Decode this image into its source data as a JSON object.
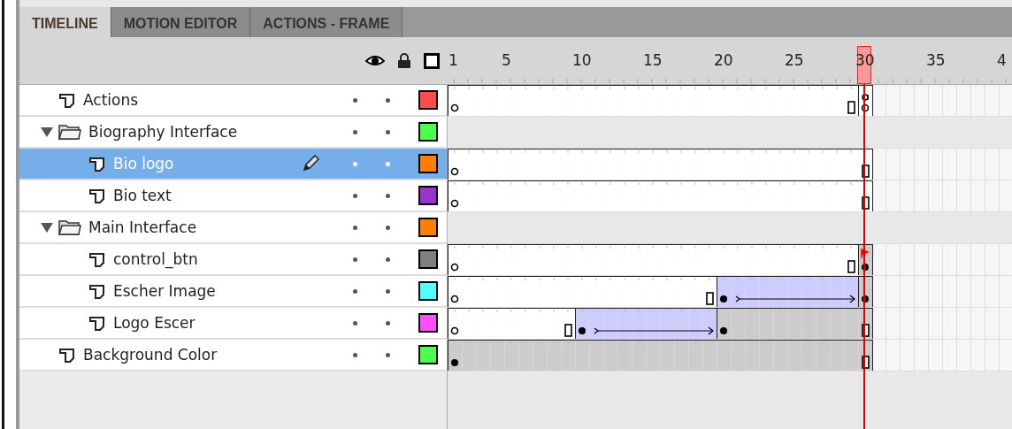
{
  "tabs": [
    {
      "label": "TIMELINE",
      "selected": true
    },
    {
      "label": "MOTION EDITOR",
      "selected": false
    },
    {
      "label": "ACTIONS - FRAME",
      "selected": false
    }
  ],
  "ruler": {
    "labels": [
      {
        "label": "1",
        "selected": false
      },
      {
        "label": "5",
        "selected": false
      },
      {
        "label": "10",
        "selected": false
      },
      {
        "label": "15",
        "selected": false
      },
      {
        "label": "20",
        "selected": false
      },
      {
        "label": "25",
        "selected": false
      },
      {
        "label": "30",
        "selected": true
      },
      {
        "label": "35",
        "selected": false
      },
      {
        "label": "4",
        "selected": false
      }
    ]
  },
  "layers": [
    {
      "name": "Actions",
      "kind": "layer",
      "selected": false,
      "color": "#ff4d4d",
      "frames": [
        {
          "kind": "blank",
          "keyframe": true
        },
        {
          "kind": "blank",
          "keyframe": false
        },
        {
          "kind": "blank",
          "keyframe": false
        },
        {
          "kind": "blank",
          "keyframe": false
        },
        {
          "kind": "blank",
          "keyframe": false
        },
        {
          "kind": "blank",
          "keyframe": false
        },
        {
          "kind": "blank",
          "keyframe": false
        },
        {
          "kind": "blank",
          "keyframe": false
        },
        {
          "kind": "blank",
          "keyframe": false
        },
        {
          "kind": "blank",
          "keyframe": false
        },
        {
          "kind": "blank",
          "keyframe": false
        },
        {
          "kind": "blank",
          "keyframe": false
        },
        {
          "kind": "blank",
          "keyframe": false
        },
        {
          "kind": "blank",
          "keyframe": false
        },
        {
          "kind": "blank",
          "keyframe": false
        },
        {
          "kind": "blank",
          "keyframe": false
        },
        {
          "kind": "blank",
          "keyframe": false
        },
        {
          "kind": "blank",
          "keyframe": false
        },
        {
          "kind": "blank",
          "keyframe": false
        },
        {
          "kind": "blank",
          "keyframe": false
        },
        {
          "kind": "blank",
          "keyframe": false
        },
        {
          "kind": "blank",
          "keyframe": false
        },
        {
          "kind": "blank",
          "keyframe": false
        },
        {
          "kind": "blank",
          "keyframe": false
        },
        {
          "kind": "blank",
          "keyframe": false
        },
        {
          "kind": "blank",
          "keyframe": false
        },
        {
          "kind": "blank",
          "keyframe": false
        },
        {
          "kind": "blank",
          "keyframe": false
        },
        {
          "kind": "blank",
          "keyframe": false
        },
        {
          "kind": "blank",
          "keyframe": true,
          "action": true
        }
      ]
    },
    {
      "name": "Biography Interface",
      "kind": "folder",
      "expanded": true,
      "selected": false,
      "color": "#4dff4d",
      "children": [
        {
          "name": "Bio logo",
          "kind": "layer",
          "selected": true,
          "color": "#ff8000",
          "frames": [
            {
              "kind": "blank",
              "keyframe": true
            },
            {
              "kind": "blank",
              "keyframe": false
            },
            {
              "kind": "blank",
              "keyframe": false
            },
            {
              "kind": "blank",
              "keyframe": false
            },
            {
              "kind": "blank",
              "keyframe": false
            },
            {
              "kind": "blank",
              "keyframe": false
            },
            {
              "kind": "blank",
              "keyframe": false
            },
            {
              "kind": "blank",
              "keyframe": false
            },
            {
              "kind": "blank",
              "keyframe": false
            },
            {
              "kind": "blank",
              "keyframe": false
            },
            {
              "kind": "blank",
              "keyframe": false
            },
            {
              "kind": "blank",
              "keyframe": false
            },
            {
              "kind": "blank",
              "keyframe": false
            },
            {
              "kind": "blank",
              "keyframe": false
            },
            {
              "kind": "blank",
              "keyframe": false
            },
            {
              "kind": "blank",
              "keyframe": false
            },
            {
              "kind": "blank",
              "keyframe": false
            },
            {
              "kind": "blank",
              "keyframe": false
            },
            {
              "kind": "blank",
              "keyframe": false
            },
            {
              "kind": "blank",
              "keyframe": false
            },
            {
              "kind": "blank",
              "keyframe": false
            },
            {
              "kind": "blank",
              "keyframe": false
            },
            {
              "kind": "blank",
              "keyframe": false
            },
            {
              "kind": "blank",
              "keyframe": false
            },
            {
              "kind": "blank",
              "keyframe": false
            },
            {
              "kind": "blank",
              "keyframe": false
            },
            {
              "kind": "blank",
              "keyframe": false
            },
            {
              "kind": "blank",
              "keyframe": false
            },
            {
              "kind": "blank",
              "keyframe": false
            },
            {
              "kind": "blank",
              "keyframe": false
            }
          ]
        },
        {
          "name": "Bio text",
          "kind": "layer",
          "selected": false,
          "color": "#9933cc",
          "frames": [
            {
              "kind": "blank",
              "keyframe": true
            },
            {
              "kind": "blank",
              "keyframe": false
            },
            {
              "kind": "blank",
              "keyframe": false
            },
            {
              "kind": "blank",
              "keyframe": false
            },
            {
              "kind": "blank",
              "keyframe": false
            },
            {
              "kind": "blank",
              "keyframe": false
            },
            {
              "kind": "blank",
              "keyframe": false
            },
            {
              "kind": "blank",
              "keyframe": false
            },
            {
              "kind": "blank",
              "keyframe": false
            },
            {
              "kind": "blank",
              "keyframe": false
            },
            {
              "kind": "blank",
              "keyframe": false
            },
            {
              "kind": "blank",
              "keyframe": false
            },
            {
              "kind": "blank",
              "keyframe": false
            },
            {
              "kind": "blank",
              "keyframe": false
            },
            {
              "kind": "blank",
              "keyframe": false
            },
            {
              "kind": "blank",
              "keyframe": false
            },
            {
              "kind": "blank",
              "keyframe": false
            },
            {
              "kind": "blank",
              "keyframe": false
            },
            {
              "kind": "blank",
              "keyframe": false
            },
            {
              "kind": "blank",
              "keyframe": false
            },
            {
              "kind": "blank",
              "keyframe": false
            },
            {
              "kind": "blank",
              "keyframe": false
            },
            {
              "kind": "blank",
              "keyframe": false
            },
            {
              "kind": "blank",
              "keyframe": false
            },
            {
              "kind": "blank",
              "keyframe": false
            },
            {
              "kind": "blank",
              "keyframe": false
            },
            {
              "kind": "blank",
              "keyframe": false
            },
            {
              "kind": "blank",
              "keyframe": false
            },
            {
              "kind": "blank",
              "keyframe": false
            },
            {
              "kind": "blank",
              "keyframe": false
            }
          ]
        }
      ]
    },
    {
      "name": "Main Interface",
      "kind": "folder",
      "expanded": true,
      "selected": false,
      "color": "#ff8000",
      "children": [
        {
          "name": "control_btn",
          "kind": "layer",
          "selected": false,
          "color": "#808080",
          "frames": [
            {
              "kind": "blank",
              "keyframe": true
            },
            {
              "kind": "blank",
              "keyframe": false
            },
            {
              "kind": "blank",
              "keyframe": false
            },
            {
              "kind": "blank",
              "keyframe": false
            },
            {
              "kind": "blank",
              "keyframe": false
            },
            {
              "kind": "blank",
              "keyframe": false
            },
            {
              "kind": "blank",
              "keyframe": false
            },
            {
              "kind": "blank",
              "keyframe": false
            },
            {
              "kind": "blank",
              "keyframe": false
            },
            {
              "kind": "blank",
              "keyframe": false
            },
            {
              "kind": "blank",
              "keyframe": false
            },
            {
              "kind": "blank",
              "keyframe": false
            },
            {
              "kind": "blank",
              "keyframe": false
            },
            {
              "kind": "blank",
              "keyframe": false
            },
            {
              "kind": "blank",
              "keyframe": false
            },
            {
              "kind": "blank",
              "keyframe": false
            },
            {
              "kind": "blank",
              "keyframe": false
            },
            {
              "kind": "blank",
              "keyframe": false
            },
            {
              "kind": "blank",
              "keyframe": false
            },
            {
              "kind": "blank",
              "keyframe": false
            },
            {
              "kind": "blank",
              "keyframe": false
            },
            {
              "kind": "blank",
              "keyframe": false
            },
            {
              "kind": "blank",
              "keyframe": false
            },
            {
              "kind": "blank",
              "keyframe": false
            },
            {
              "kind": "blank",
              "keyframe": false
            },
            {
              "kind": "blank",
              "keyframe": false
            },
            {
              "kind": "blank",
              "keyframe": false
            },
            {
              "kind": "blank",
              "keyframe": false
            },
            {
              "kind": "blank",
              "keyframe": false
            },
            {
              "kind": "static",
              "keyframe": true,
              "flag": true
            }
          ]
        },
        {
          "name": "Escher Image",
          "kind": "layer",
          "selected": false,
          "color": "#4dffff",
          "frames": [
            {
              "kind": "blank",
              "keyframe": true
            },
            {
              "kind": "blank",
              "keyframe": false
            },
            {
              "kind": "blank",
              "keyframe": false
            },
            {
              "kind": "blank",
              "keyframe": false
            },
            {
              "kind": "blank",
              "keyframe": false
            },
            {
              "kind": "blank",
              "keyframe": false
            },
            {
              "kind": "blank",
              "keyframe": false
            },
            {
              "kind": "blank",
              "keyframe": false
            },
            {
              "kind": "blank",
              "keyframe": false
            },
            {
              "kind": "blank",
              "keyframe": false
            },
            {
              "kind": "blank",
              "keyframe": false
            },
            {
              "kind": "blank",
              "keyframe": false
            },
            {
              "kind": "blank",
              "keyframe": false
            },
            {
              "kind": "blank",
              "keyframe": false
            },
            {
              "kind": "blank",
              "keyframe": false
            },
            {
              "kind": "blank",
              "keyframe": false
            },
            {
              "kind": "blank",
              "keyframe": false
            },
            {
              "kind": "blank",
              "keyframe": false
            },
            {
              "kind": "blank",
              "keyframe": false
            },
            {
              "kind": "tween",
              "keyframe": true
            },
            {
              "kind": "tween",
              "keyframe": false
            },
            {
              "kind": "tween",
              "keyframe": false
            },
            {
              "kind": "tween",
              "keyframe": false
            },
            {
              "kind": "tween",
              "keyframe": false
            },
            {
              "kind": "tween",
              "keyframe": false
            },
            {
              "kind": "tween",
              "keyframe": false
            },
            {
              "kind": "tween",
              "keyframe": false
            },
            {
              "kind": "tween",
              "keyframe": false
            },
            {
              "kind": "tween",
              "keyframe": false
            },
            {
              "kind": "static",
              "keyframe": true
            }
          ]
        },
        {
          "name": "Logo Escer",
          "kind": "layer",
          "selected": false,
          "color": "#ff4dff",
          "frames": [
            {
              "kind": "blank",
              "keyframe": true
            },
            {
              "kind": "blank",
              "keyframe": false
            },
            {
              "kind": "blank",
              "keyframe": false
            },
            {
              "kind": "blank",
              "keyframe": false
            },
            {
              "kind": "blank",
              "keyframe": false
            },
            {
              "kind": "blank",
              "keyframe": false
            },
            {
              "kind": "blank",
              "keyframe": false
            },
            {
              "kind": "blank",
              "keyframe": false
            },
            {
              "kind": "blank",
              "keyframe": false
            },
            {
              "kind": "tween",
              "keyframe": true
            },
            {
              "kind": "tween",
              "keyframe": false
            },
            {
              "kind": "tween",
              "keyframe": false
            },
            {
              "kind": "tween",
              "keyframe": false
            },
            {
              "kind": "tween",
              "keyframe": false
            },
            {
              "kind": "tween",
              "keyframe": false
            },
            {
              "kind": "tween",
              "keyframe": false
            },
            {
              "kind": "tween",
              "keyframe": false
            },
            {
              "kind": "tween",
              "keyframe": false
            },
            {
              "kind": "tween",
              "keyframe": false
            },
            {
              "kind": "static",
              "keyframe": true
            },
            {
              "kind": "static",
              "keyframe": false
            },
            {
              "kind": "static",
              "keyframe": false
            },
            {
              "kind": "static",
              "keyframe": false
            },
            {
              "kind": "static",
              "keyframe": false
            },
            {
              "kind": "static",
              "keyframe": false
            },
            {
              "kind": "static",
              "keyframe": false
            },
            {
              "kind": "static",
              "keyframe": false
            },
            {
              "kind": "static",
              "keyframe": false
            },
            {
              "kind": "static",
              "keyframe": false
            },
            {
              "kind": "static",
              "keyframe": false
            }
          ]
        }
      ]
    },
    {
      "name": "Background Color",
      "kind": "layer",
      "selected": false,
      "color": "#4dff4d",
      "frames": [
        {
          "kind": "static",
          "keyframe": true
        },
        {
          "kind": "static",
          "keyframe": false
        },
        {
          "kind": "static",
          "keyframe": false
        },
        {
          "kind": "static",
          "keyframe": false
        },
        {
          "kind": "static",
          "keyframe": false
        },
        {
          "kind": "static",
          "keyframe": false
        },
        {
          "kind": "static",
          "keyframe": false
        },
        {
          "kind": "static",
          "keyframe": false
        },
        {
          "kind": "static",
          "keyframe": false
        },
        {
          "kind": "static",
          "keyframe": false
        },
        {
          "kind": "static",
          "keyframe": false
        },
        {
          "kind": "static",
          "keyframe": false
        },
        {
          "kind": "static",
          "keyframe": false
        },
        {
          "kind": "static",
          "keyframe": false
        },
        {
          "kind": "static",
          "keyframe": false
        },
        {
          "kind": "static",
          "keyframe": false
        },
        {
          "kind": "static",
          "keyframe": false
        },
        {
          "kind": "static",
          "keyframe": false
        },
        {
          "kind": "static",
          "keyframe": false
        },
        {
          "kind": "static",
          "keyframe": false
        },
        {
          "kind": "static",
          "keyframe": false
        },
        {
          "kind": "static",
          "keyframe": false
        },
        {
          "kind": "static",
          "keyframe": false
        },
        {
          "kind": "static",
          "keyframe": false
        },
        {
          "kind": "static",
          "keyframe": false
        },
        {
          "kind": "static",
          "keyframe": false
        },
        {
          "kind": "static",
          "keyframe": false
        },
        {
          "kind": "static",
          "keyframe": false
        },
        {
          "kind": "static",
          "keyframe": false
        },
        {
          "kind": "static",
          "keyframe": false
        }
      ]
    }
  ]
}
